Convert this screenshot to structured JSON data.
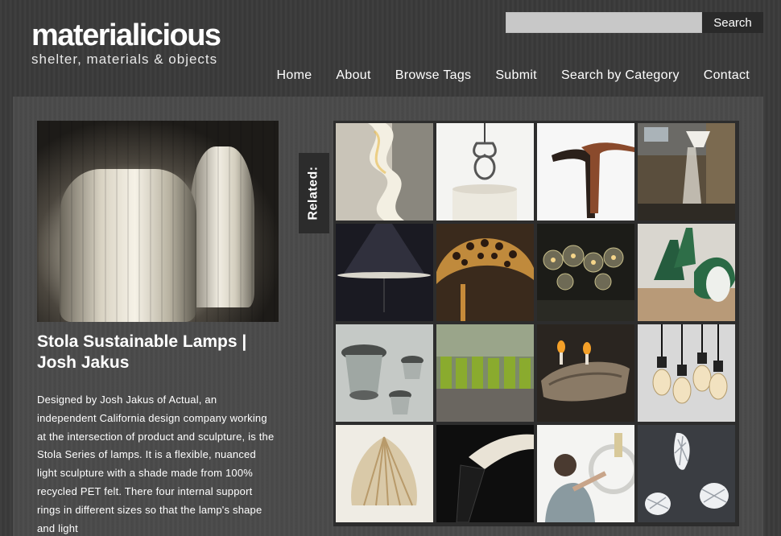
{
  "site": {
    "title": "materialicious",
    "tagline": "shelter, materials & objects"
  },
  "search": {
    "placeholder": "",
    "button_label": "Search"
  },
  "nav": {
    "items": [
      {
        "label": "Home"
      },
      {
        "label": "About"
      },
      {
        "label": "Browse Tags"
      },
      {
        "label": "Submit"
      },
      {
        "label": "Search by Category"
      },
      {
        "label": "Contact"
      }
    ]
  },
  "post": {
    "title": "Stola Sustainable Lamps | Josh Jakus",
    "body": "Designed by Josh Jakus of Actual, an independent California design company working at the intersection of product and sculpture, is the Stola Series of lamps. It is a flexible, nuanced light sculpture with a shade made from 100% recycled PET felt. There four internal support rings in different sizes so that the lamp's shape and light"
  },
  "related": {
    "label": "Related:",
    "thumbnails": [
      {
        "icon": "twisted-white-sculpture-lamp"
      },
      {
        "icon": "ornate-pendant-lamp"
      },
      {
        "icon": "bent-wood-desk-lamp"
      },
      {
        "icon": "lamp-in-brick-room"
      },
      {
        "icon": "dark-disc-light"
      },
      {
        "icon": "perforated-dome-lamp"
      },
      {
        "icon": "glass-bulb-chandelier"
      },
      {
        "icon": "green-enamel-pendants"
      },
      {
        "icon": "industrial-cage-lamps"
      },
      {
        "icon": "green-bottle-wall"
      },
      {
        "icon": "driftwood-candle-holder"
      },
      {
        "icon": "edison-bulb-pendants"
      },
      {
        "icon": "paper-layered-lamp"
      },
      {
        "icon": "folded-sheet-lamp"
      },
      {
        "icon": "woman-with-ring-lamp"
      },
      {
        "icon": "white-lattice-lamps"
      }
    ]
  },
  "colors": {
    "background": "#3a3a3a",
    "panel": "#4a4a4a",
    "grid_frame": "#2d2d2d",
    "text": "#ffffff"
  }
}
